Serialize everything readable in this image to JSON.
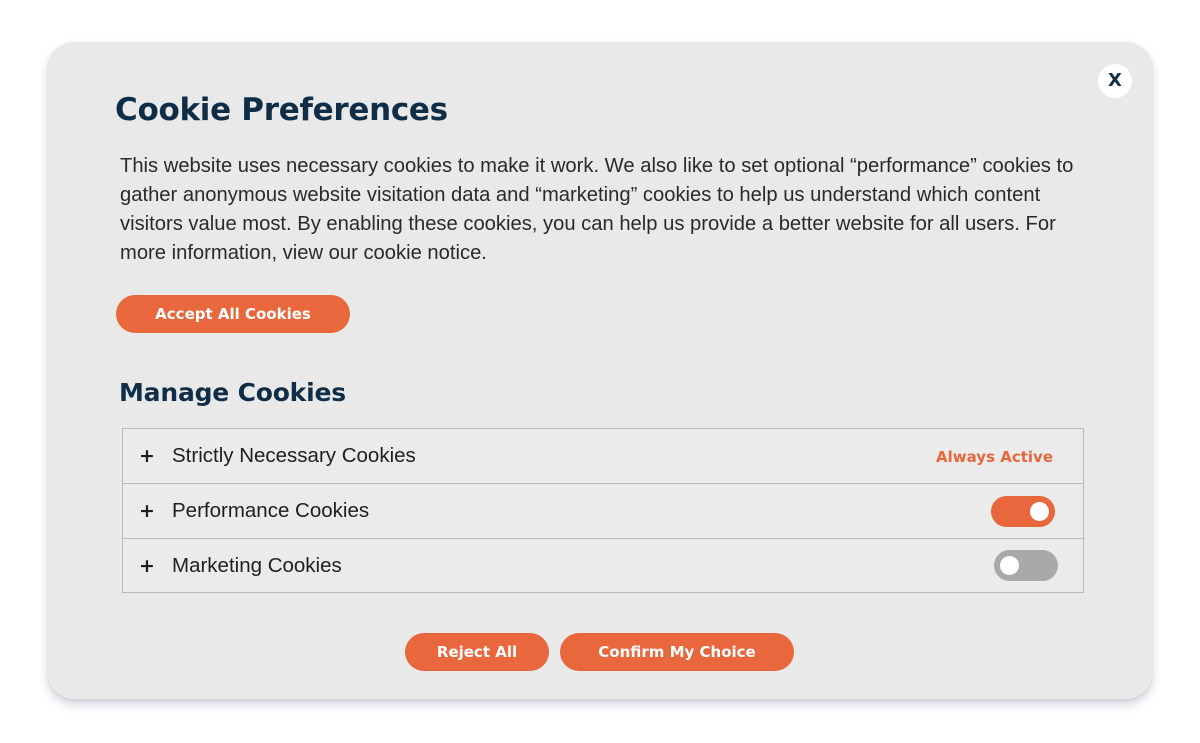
{
  "dialog": {
    "close_label": "X",
    "title": "Cookie Preferences",
    "intro": "This website uses necessary cookies to make it work. We also like to set optional “performance” cookies to gather anonymous website visitation data and “marketing” cookies to help us understand which content visitors value most. By enabling these cookies, you can help us provide a better website for all users. For more information, view our cookie notice.",
    "accept_all_label": "Accept All Cookies"
  },
  "manage": {
    "heading": "Manage Cookies",
    "categories": [
      {
        "expand_symbol": "+",
        "label": "Strictly Necessary Cookies",
        "status": "Always Active"
      },
      {
        "expand_symbol": "+",
        "label": "Performance Cookies",
        "toggle_on": true
      },
      {
        "expand_symbol": "+",
        "label": "Marketing Cookies",
        "toggle_on": false
      }
    ]
  },
  "footer": {
    "reject_label": "Reject All",
    "confirm_label": "Confirm My Choice"
  },
  "colors": {
    "accent": "#e8673c",
    "heading": "#0f2d46",
    "panel_background": "#e9e9e9",
    "toggle_off": "#a9a9a9"
  }
}
